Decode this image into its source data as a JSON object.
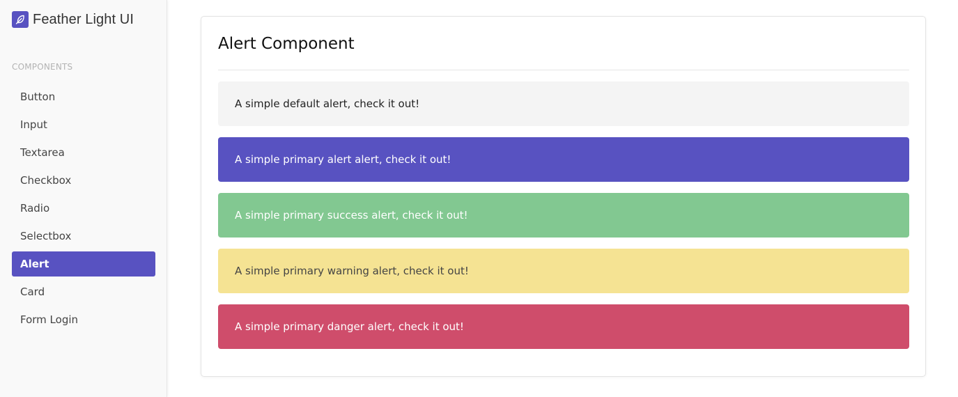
{
  "brand": {
    "title": "Feather Light UI",
    "icon": "feather-icon",
    "accent_color": "#5852c1"
  },
  "sidebar": {
    "section_label": "COMPONENTS",
    "items": [
      {
        "label": "Button",
        "active": false
      },
      {
        "label": "Input",
        "active": false
      },
      {
        "label": "Textarea",
        "active": false
      },
      {
        "label": "Checkbox",
        "active": false
      },
      {
        "label": "Radio",
        "active": false
      },
      {
        "label": "Selectbox",
        "active": false
      },
      {
        "label": "Alert",
        "active": true
      },
      {
        "label": "Card",
        "active": false
      },
      {
        "label": "Form Login",
        "active": false
      }
    ]
  },
  "main": {
    "title": "Alert Component",
    "alerts": [
      {
        "variant": "default",
        "text": "A simple default alert, check it out!",
        "background": "#f4f4f4",
        "color": "#222222"
      },
      {
        "variant": "primary",
        "text": "A simple primary alert alert, check it out!",
        "background": "#5852c1",
        "color": "#ffffff"
      },
      {
        "variant": "success",
        "text": "A simple primary success alert, check it out!",
        "background": "#82c891",
        "color": "#ffffff"
      },
      {
        "variant": "warning",
        "text": "A simple primary warning alert, check it out!",
        "background": "#f5e393",
        "color": "#444444"
      },
      {
        "variant": "danger",
        "text": "A simple primary danger alert, check it out!",
        "background": "#cf4d6b",
        "color": "#ffffff"
      }
    ]
  }
}
